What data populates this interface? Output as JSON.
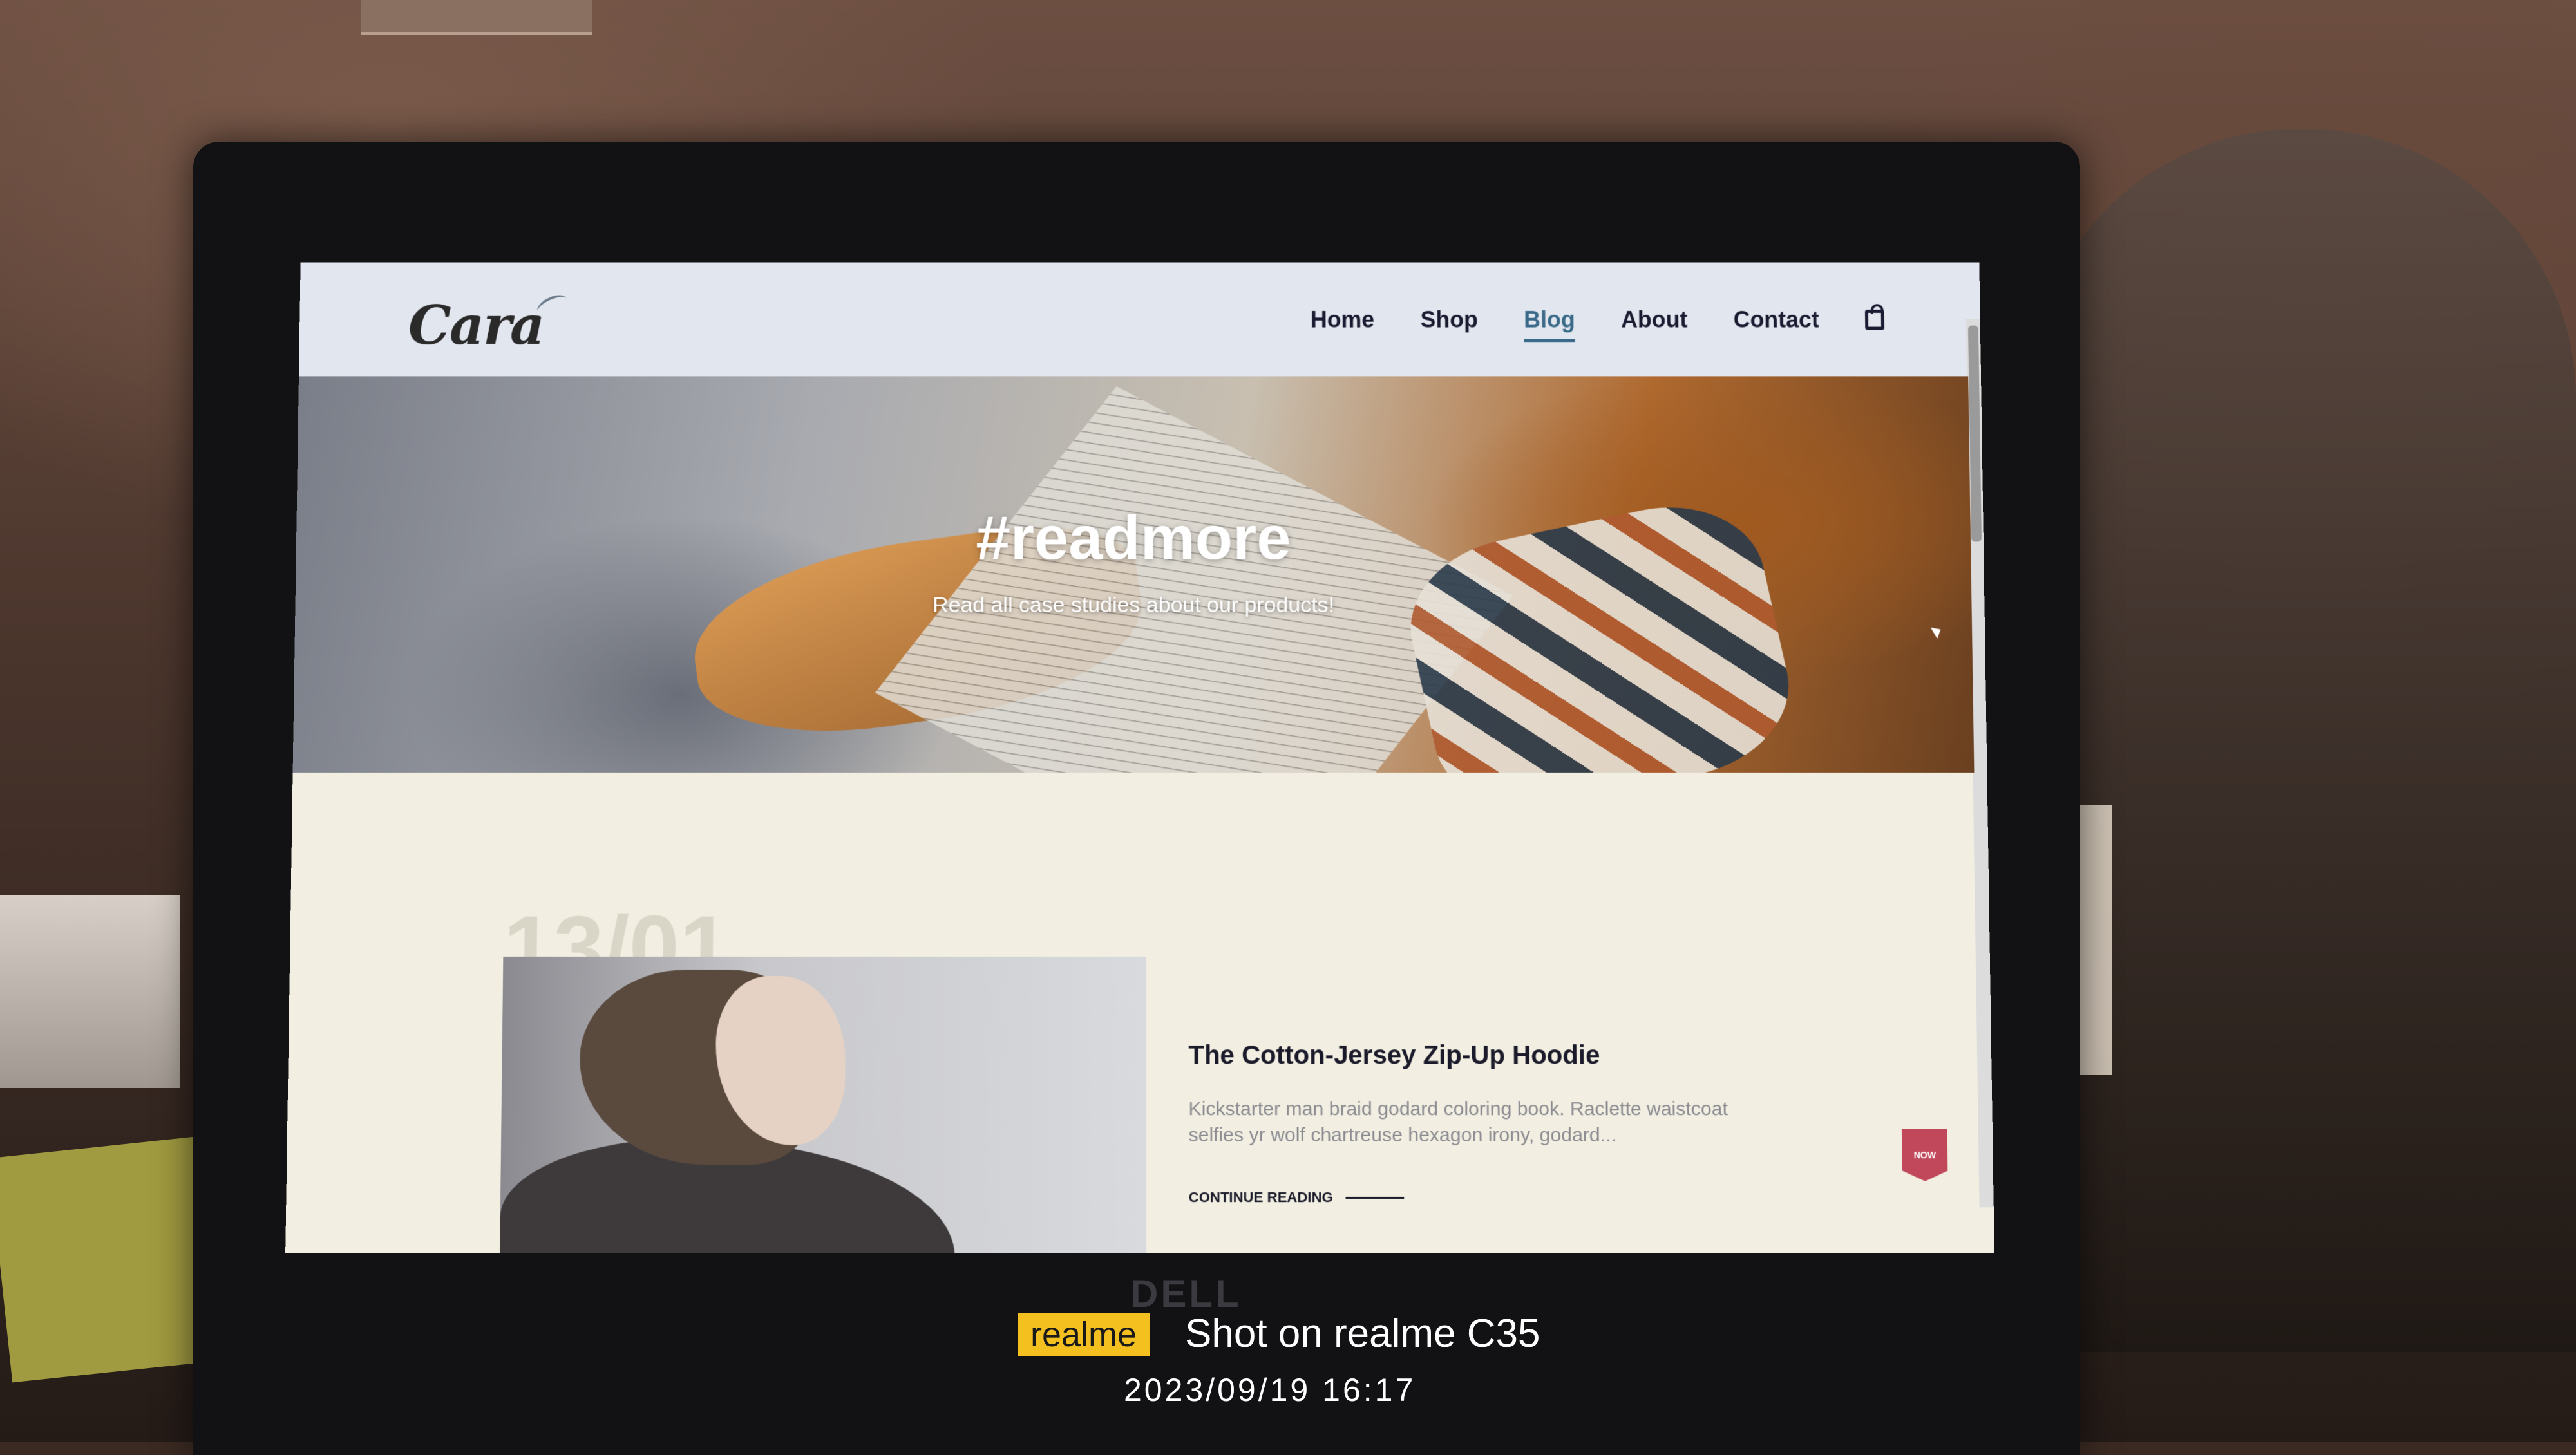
{
  "site": {
    "logo_text": "Cara",
    "nav": [
      {
        "label": "Home"
      },
      {
        "label": "Shop"
      },
      {
        "label": "Blog"
      },
      {
        "label": "About"
      },
      {
        "label": "Contact"
      }
    ],
    "active_nav": "Blog",
    "cart_icon": "shopping-bag-icon"
  },
  "hero": {
    "title": "#readmore",
    "subtitle": "Read all case studies about our products!"
  },
  "post": {
    "date": "13/01",
    "title": "The Cotton-Jersey Zip-Up Hoodie",
    "excerpt": "Kickstarter man braid godard coloring book. Raclette waistcoat selfies yr wolf chartreuse hexagon irony, godard...",
    "read_more": "CONTINUE READING",
    "badge_text": "NOW"
  },
  "device": {
    "brand": "DELL"
  },
  "watermark": {
    "tag": "realme",
    "text": "Shot on realme C35",
    "datetime": "2023/09/19  16:17"
  },
  "colors": {
    "nav_active": "#3a6a8a",
    "watermark_tag": "#f4c020"
  }
}
